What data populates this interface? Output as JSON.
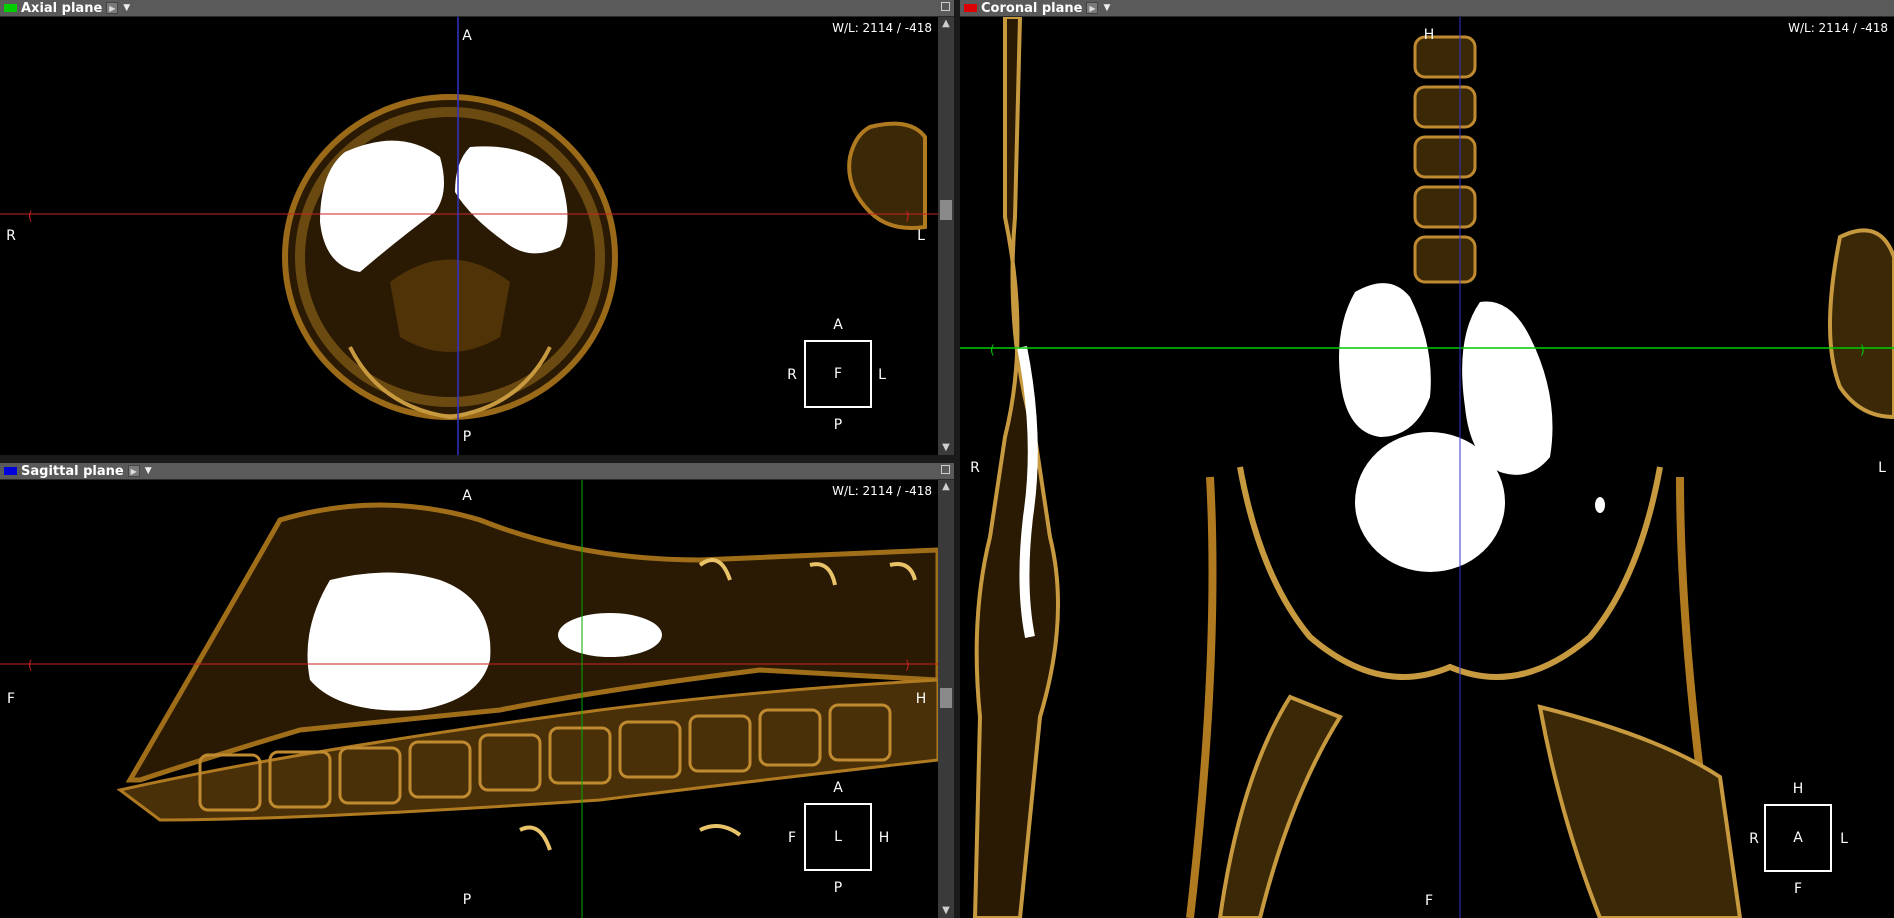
{
  "panels": {
    "axial": {
      "title": "Axial plane",
      "swatch_color": "#00cc00",
      "wl": "W/L: 2114 / -418",
      "labels": {
        "top": "A",
        "bottom": "P",
        "left": "R",
        "right": "L"
      },
      "cube": {
        "top": "A",
        "bottom": "P",
        "left": "R",
        "right": "L",
        "center": "F"
      }
    },
    "sagittal": {
      "title": "Sagittal plane",
      "swatch_color": "#0000dd",
      "wl": "W/L: 2114 / -418",
      "labels": {
        "top": "A",
        "bottom": "P",
        "left": "F",
        "right": "H"
      },
      "cube": {
        "top": "A",
        "bottom": "P",
        "left": "F",
        "right": "H",
        "center": "L"
      }
    },
    "coronal": {
      "title": "Coronal plane",
      "swatch_color": "#dd0000",
      "wl": "W/L: 2114 / -418",
      "labels": {
        "top": "H",
        "bottom": "F",
        "left": "R",
        "right": "L"
      },
      "cube": {
        "top": "H",
        "bottom": "F",
        "left": "R",
        "right": "L",
        "center": "A"
      }
    }
  },
  "icons": {
    "menu_arrow": "play-icon",
    "dropdown": "chevron-down-icon",
    "maximize": "maximize-icon",
    "scroll_up": "scroll-up-arrow-icon",
    "scroll_down": "scroll-down-arrow-icon"
  },
  "colors": {
    "crosshair_axial": "#00cc00",
    "crosshair_coronal": "#cc2222",
    "crosshair_sagittal": "#3333cc",
    "tissue": "#8a5a10",
    "bone": "#e8c36a"
  }
}
